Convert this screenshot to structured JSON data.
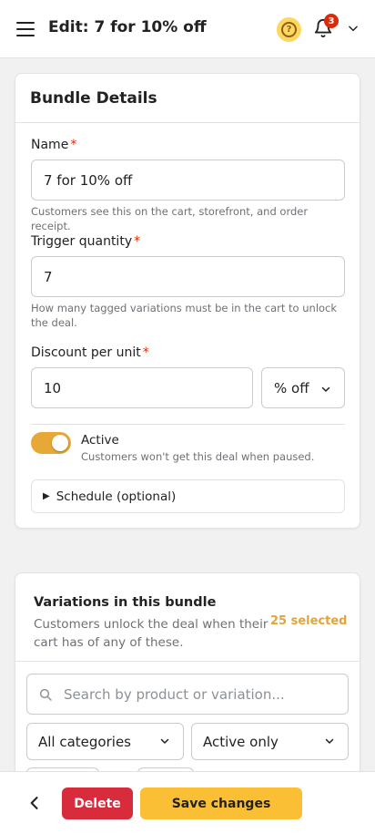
{
  "header": {
    "title": "Edit: 7 for 10% off",
    "notification_count": "3",
    "icons": [
      "menu-icon",
      "help-icon",
      "bell-icon",
      "chevron-down-icon"
    ]
  },
  "bundle_details": {
    "title": "Bundle Details",
    "required_marker": "*",
    "name": {
      "label": "Name",
      "value": "7 for 10% off",
      "help": "Customers see this on the cart, storefront, and order receipt."
    },
    "trigger_quantity": {
      "label": "Trigger quantity",
      "value": "7",
      "help": "How many tagged variations must be in the cart to unlock the deal."
    },
    "discount": {
      "label": "Discount per unit",
      "value": "10",
      "type_selected": "% off"
    },
    "active": {
      "label": "Active",
      "help": "Customers won't get this deal when paused.",
      "on": true
    },
    "schedule": {
      "label": "Schedule (optional)"
    }
  },
  "variations": {
    "title": "Variations in this bundle",
    "subtitle": "Customers unlock the deal when their cart has of any of these.",
    "selected_count": "25 selected",
    "search_placeholder": "Search by product or variation...",
    "category_filter": "All categories",
    "status_filter": "Active only"
  },
  "footer": {
    "delete_label": "Delete",
    "save_label": "Save changes"
  },
  "colors": {
    "accent": "#fbbf36",
    "danger": "#d82c3c",
    "toggle_on": "#e8a838",
    "selected_count": "#e1a53a"
  }
}
